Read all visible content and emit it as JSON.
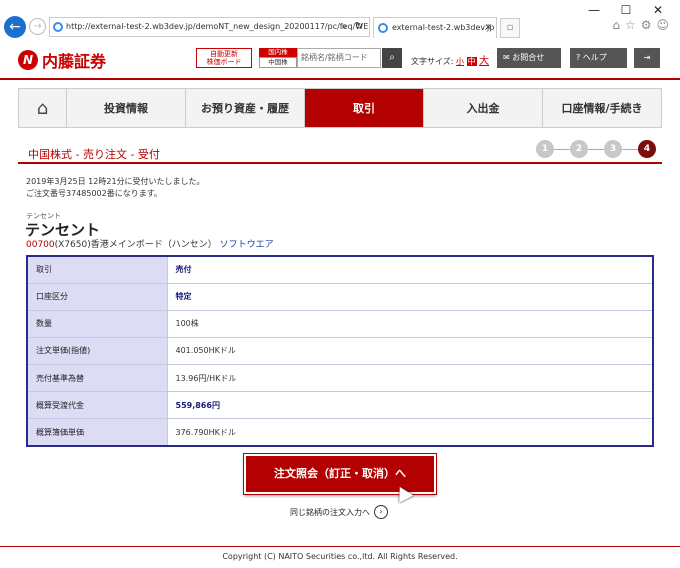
{
  "browser": {
    "window_controls": [
      "—",
      "☐",
      "✕"
    ],
    "url": "http://external-test-2.wb3dev.jp/demoNT_new_design_20200117/pc/feq/WE",
    "tab_title": "external-test-2.wb3dev.jp"
  },
  "header": {
    "logo_text": "内藤証券",
    "auto_update_line1": "自動更新",
    "auto_update_line2": "株価ボード",
    "market_a": "国内株",
    "market_b": "中国株",
    "search_placeholder": "銘柄名/銘柄コード",
    "font_size_label": "文字サイズ:",
    "font_small": "小",
    "font_medium": "中",
    "font_large": "大",
    "contact": "お問合せ",
    "help": "ヘルプ"
  },
  "nav": {
    "items": [
      "投資情報",
      "お預り資産・履歴",
      "取引",
      "入出金",
      "口座情報/手続き"
    ]
  },
  "page": {
    "title": "中国株式 - 売り注文 - 受付",
    "steps": [
      "1",
      "2",
      "3",
      "4"
    ],
    "message_line1": "2019年3月25日 12時21分に受付いたしました。",
    "message_line2": "ご注文番号37485002番になります。"
  },
  "stock": {
    "ruby": "テンセント",
    "name": "テンセント",
    "code": "00700",
    "info": "(X7650)香港メインボード（ハンセン）",
    "sector": "ソフトウエア"
  },
  "detail": {
    "rows": [
      {
        "label": "取引",
        "value": "売付"
      },
      {
        "label": "口座区分",
        "value": "特定"
      },
      {
        "label": "数量",
        "value": "100株"
      },
      {
        "label": "注文単価(指値)",
        "value": "401.050HKドル"
      },
      {
        "label": "売付基準為替",
        "value": "13.96円/HKドル"
      },
      {
        "label": "概算受渡代金",
        "value": "559,866円"
      },
      {
        "label": "概算簿価単価",
        "value": "376.790HKドル"
      }
    ]
  },
  "actions": {
    "order_inquiry": "注文照会（訂正・取消）へ",
    "same_stock": "同じ銘柄の注文入力へ"
  },
  "footer": {
    "copyright": "Copyright (C) NAITO Securities co.,ltd. All Rights Reserved."
  }
}
